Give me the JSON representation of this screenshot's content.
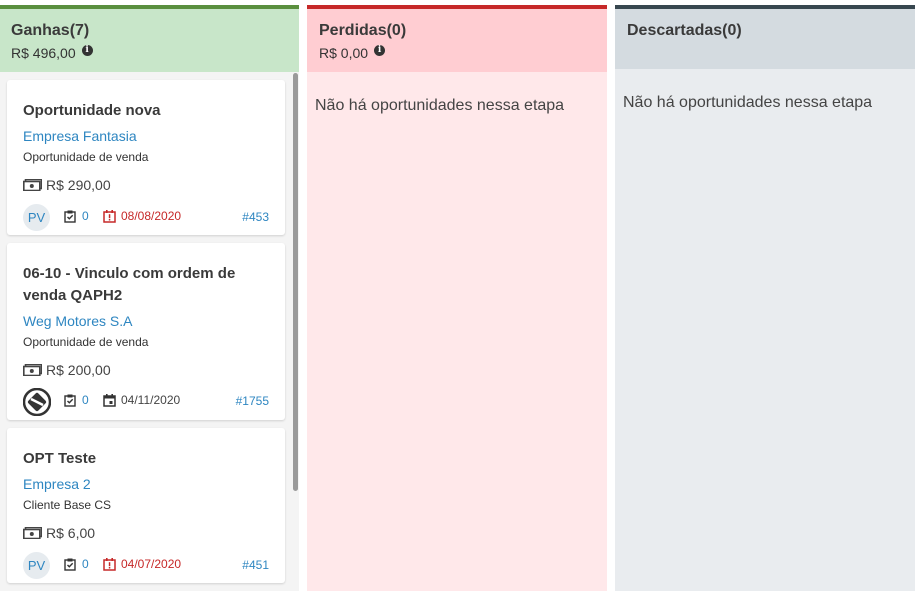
{
  "columns": {
    "ganhas": {
      "title": "Ganhas(7)",
      "total": "R$ 496,00",
      "color": "#5a8f3e"
    },
    "perdidas": {
      "title": "Perdidas(0)",
      "total": "R$ 0,00",
      "empty": "Não há oportunidades nessa etapa",
      "color": "#c62828"
    },
    "descartadas": {
      "title": "Descartadas(0)",
      "empty": "Não há oportunidades nessa etapa",
      "color": "#37474f"
    }
  },
  "cards": [
    {
      "title": "Oportunidade nova",
      "company": "Empresa Fantasia",
      "type": "Oportunidade de venda",
      "value": "R$ 290,00",
      "avatar": "PV",
      "tasks": "0",
      "date": "08/08/2020",
      "date_status": "late",
      "id": "#453"
    },
    {
      "title": "06-10 - Vinculo com ordem de venda QAPH2",
      "company": "Weg Motores S.A",
      "type": "Oportunidade de venda",
      "value": "R$ 200,00",
      "avatar": "logo",
      "tasks": "0",
      "date": "04/11/2020",
      "date_status": "ok",
      "id": "#1755"
    },
    {
      "title": "OPT Teste",
      "company": "Empresa 2",
      "type": "Cliente Base CS",
      "value": "R$ 6,00",
      "avatar": "PV",
      "tasks": "0",
      "date": "04/07/2020",
      "date_status": "late",
      "id": "#451"
    }
  ],
  "icons": {
    "info": "info-icon",
    "money": "cash-icon",
    "tasks": "checklist-icon",
    "date_late": "calendar-alert-icon",
    "date_ok": "calendar-icon"
  },
  "colors": {
    "link": "#2e86c1",
    "late": "#c62828"
  }
}
